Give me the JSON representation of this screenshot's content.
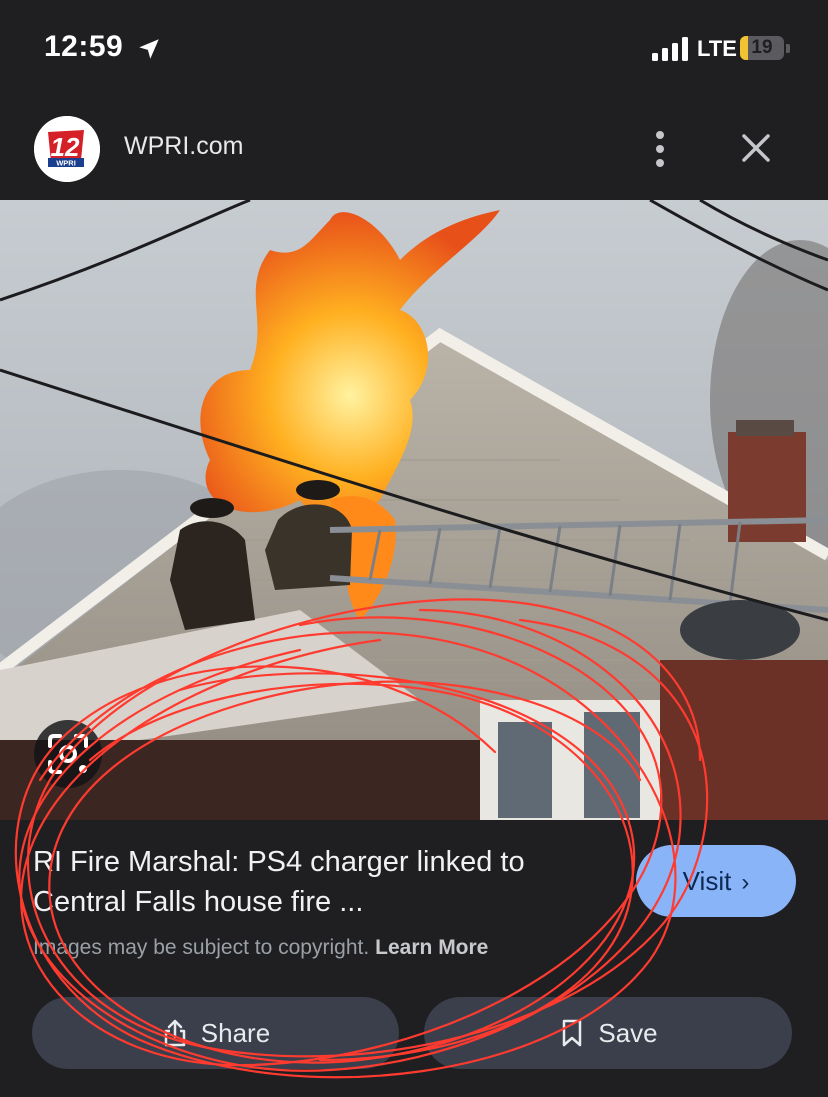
{
  "status_bar": {
    "time": "12:59",
    "network": "LTE",
    "battery_level": "19",
    "battery_fraction": 0.19,
    "icons": [
      "location-arrow-icon",
      "signal-bars-icon",
      "battery-icon"
    ]
  },
  "header": {
    "site_name": "WPRI.com",
    "logo_text": "12 WPRI",
    "icons": [
      "more-vert-icon",
      "close-icon"
    ]
  },
  "image": {
    "icons": [
      "lens-icon"
    ]
  },
  "result": {
    "title": "RI Fire Marshal: PS4 charger linked to Central Falls house fire ...",
    "visit_label": "Visit",
    "copyright_text": "Images may be subject to copyright.",
    "learn_more": "Learn More"
  },
  "actions": {
    "share_label": "Share",
    "save_label": "Save",
    "icons": [
      "share-icon",
      "bookmark-icon"
    ]
  },
  "colors": {
    "background": "#1f1f22",
    "visit_button": "#8ab4f8",
    "action_button": "#3a3f4b",
    "annotation_stroke": "#ff3b30",
    "battery": "#f2c230"
  }
}
